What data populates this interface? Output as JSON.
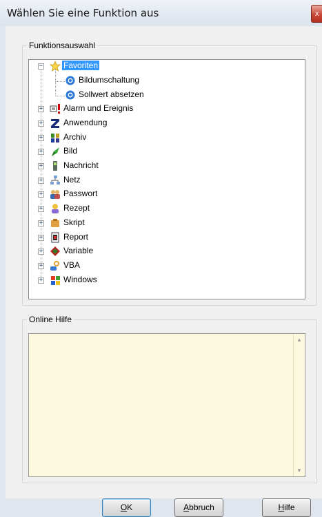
{
  "window": {
    "title": "Wählen Sie eine Funktion aus",
    "close_label": "x"
  },
  "funktionsauswahl": {
    "label": "Funktionsauswahl",
    "favorites": {
      "label": "Favoriten",
      "expanded": true,
      "selected": true,
      "children": [
        {
          "label": "Bildumschaltung",
          "icon": "function-gear-icon"
        },
        {
          "label": "Sollwert absetzen",
          "icon": "function-gear-icon"
        }
      ]
    },
    "items": [
      {
        "label": "Alarm und Ereignis",
        "icon": "alarm-event-icon"
      },
      {
        "label": "Anwendung",
        "icon": "application-z-icon"
      },
      {
        "label": "Archiv",
        "icon": "archive-icon"
      },
      {
        "label": "Bild",
        "icon": "picture-icon"
      },
      {
        "label": "Nachricht",
        "icon": "message-phone-icon"
      },
      {
        "label": "Netz",
        "icon": "network-icon"
      },
      {
        "label": "Passwort",
        "icon": "users-icon"
      },
      {
        "label": "Rezept",
        "icon": "recipe-icon"
      },
      {
        "label": "Skript",
        "icon": "script-icon"
      },
      {
        "label": "Report",
        "icon": "report-icon"
      },
      {
        "label": "Variable",
        "icon": "variable-icon"
      },
      {
        "label": "VBA",
        "icon": "vba-icon"
      },
      {
        "label": "Windows",
        "icon": "windows-icon"
      }
    ]
  },
  "online_hilfe": {
    "label": "Online Hilfe",
    "text": ""
  },
  "buttons": {
    "ok_prefix": "",
    "ok_accel": "O",
    "ok_rest": "K",
    "abbruch_prefix": "",
    "abbruch_accel": "A",
    "abbruch_rest": "bbruch",
    "hilfe_prefix": "",
    "hilfe_accel": "H",
    "hilfe_rest": "ilfe"
  },
  "colors": {
    "selection": "#3399ff",
    "help_background": "#fdf9df",
    "dialog_background": "#f0f0f0"
  }
}
